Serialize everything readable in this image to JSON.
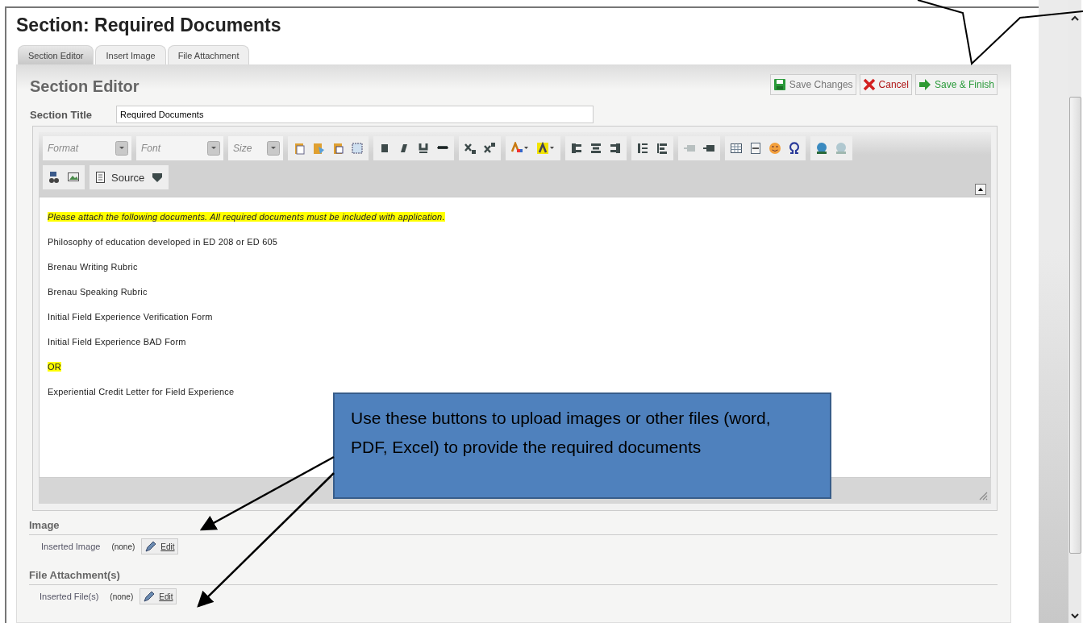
{
  "page_title": "Section: Required Documents",
  "tabs": [
    {
      "label": "Section Editor",
      "selected": true
    },
    {
      "label": "Insert Image",
      "selected": false
    },
    {
      "label": "File Attachment",
      "selected": false
    }
  ],
  "panel": {
    "title": "Section Editor",
    "buttons": [
      {
        "kind": "save",
        "label": "Save Changes"
      },
      {
        "kind": "cancel",
        "label": "Cancel"
      },
      {
        "kind": "finish",
        "label": "Save & Finish"
      }
    ]
  },
  "section_title": {
    "label": "Section Title",
    "value": "Required Documents"
  },
  "editor": {
    "dropdowns": [
      {
        "placeholder": "Format"
      },
      {
        "placeholder": "Font"
      },
      {
        "placeholder": "Size"
      }
    ],
    "source_label": "Source",
    "paragraphs": [
      {
        "text": "Please attach the following documents.  All required documents must be included with application.",
        "highlighted": true,
        "italic": true
      },
      {
        "text": "Philosophy of education developed in ED 208 or ED 605",
        "highlighted": false,
        "italic": false
      },
      {
        "text": "Brenau Writing Rubric",
        "highlighted": false,
        "italic": false
      },
      {
        "text": "Brenau Speaking Rubric",
        "highlighted": false,
        "italic": false
      },
      {
        "text": "Initial Field Experience Verification Form",
        "highlighted": false,
        "italic": false
      },
      {
        "text": "Initial Field Experience BAD Form",
        "highlighted": false,
        "italic": false
      },
      {
        "text": "OR",
        "highlighted": true,
        "italic": false
      },
      {
        "text": "Experiential Credit Letter for Field Experience",
        "highlighted": false,
        "italic": false
      }
    ]
  },
  "attachments": [
    {
      "heading": "Image",
      "label": "Inserted Image",
      "value": "(none)",
      "action": "Edit"
    },
    {
      "heading": "File Attachment(s)",
      "label": "Inserted File(s)",
      "value": "(none)",
      "action": "Edit"
    }
  ],
  "callout": {
    "text": "Use these buttons to upload images or other files (word, PDF, Excel) to provide the required documents"
  }
}
